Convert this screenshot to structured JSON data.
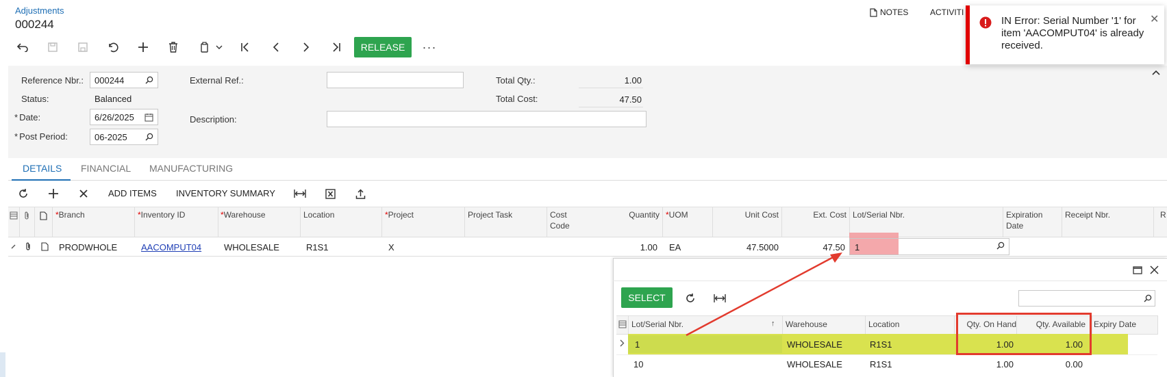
{
  "header": {
    "breadcrumb": "Adjustments",
    "title": "000244",
    "notes_label": "NOTES",
    "activities_label": "ACTIVITI"
  },
  "toolbar": {
    "release_label": "RELEASE",
    "more_label": "···"
  },
  "toast": {
    "message": "IN Error: Serial Number '1' for item 'AACOMPUT04' is already received.",
    "close_label": "✕",
    "color": "#e00000"
  },
  "form": {
    "reference_nbr_label": "Reference Nbr.:",
    "reference_nbr_value": "000244",
    "status_label": "Status:",
    "status_value": "Balanced",
    "date_label": "Date:",
    "date_value": "6/26/2025",
    "post_period_label": "Post Period:",
    "post_period_value": "06-2025",
    "external_ref_label": "External Ref.:",
    "external_ref_value": "",
    "description_label": "Description:",
    "description_value": "",
    "total_qty_label": "Total Qty.:",
    "total_qty_value": "1.00",
    "total_cost_label": "Total Cost:",
    "total_cost_value": "47.50",
    "required_mark": "*"
  },
  "tabs": [
    {
      "label": "DETAILS",
      "active": true
    },
    {
      "label": "FINANCIAL",
      "active": false
    },
    {
      "label": "MANUFACTURING",
      "active": false
    }
  ],
  "grid_toolbar": {
    "add_items": "ADD ITEMS",
    "inventory_summary": "INVENTORY SUMMARY"
  },
  "grid": {
    "columns": {
      "branch": "Branch",
      "inventory_id": "Inventory ID",
      "warehouse": "Warehouse",
      "location": "Location",
      "project": "Project",
      "project_task": "Project Task",
      "cost_code_1": "Cost",
      "cost_code_2": "Code",
      "quantity": "Quantity",
      "uom": "UOM",
      "unit_cost": "Unit Cost",
      "ext_cost": "Ext. Cost",
      "lot_serial": "Lot/Serial Nbr.",
      "expiration_1": "Expiration",
      "expiration_2": "Date",
      "receipt_nbr": "Receipt Nbr.",
      "r": "R",
      "star": "*"
    },
    "row": {
      "branch": "PRODWHOLE",
      "inventory_id": "AACOMPUT04",
      "warehouse": "WHOLESALE",
      "location": "R1S1",
      "project": "X",
      "quantity": "1.00",
      "uom": "EA",
      "unit_cost": "47.5000",
      "ext_cost": "47.50",
      "lot_serial": "1"
    }
  },
  "lookup": {
    "select_label": "SELECT",
    "columns": {
      "lot_serial": "Lot/Serial Nbr.",
      "warehouse": "Warehouse",
      "location": "Location",
      "qty_on_hand": "Qty. On Hand",
      "qty_available": "Qty. Available",
      "expiry_date": "Expiry Date",
      "sort_mark": "↑"
    },
    "rows": [
      {
        "lot_serial": "1",
        "warehouse": "WHOLESALE",
        "location": "R1S1",
        "qty_on_hand": "1.00",
        "qty_available": "1.00"
      },
      {
        "lot_serial": "10",
        "warehouse": "WHOLESALE",
        "location": "R1S1",
        "qty_on_hand": "1.00",
        "qty_available": "0.00"
      }
    ]
  },
  "colors": {
    "accent": "#1f6fb5",
    "release": "#2ea44f",
    "highlight_yellow": "#d9e24f",
    "annotation_red": "#e23b2e",
    "lot_highlight": "#f2999c"
  }
}
